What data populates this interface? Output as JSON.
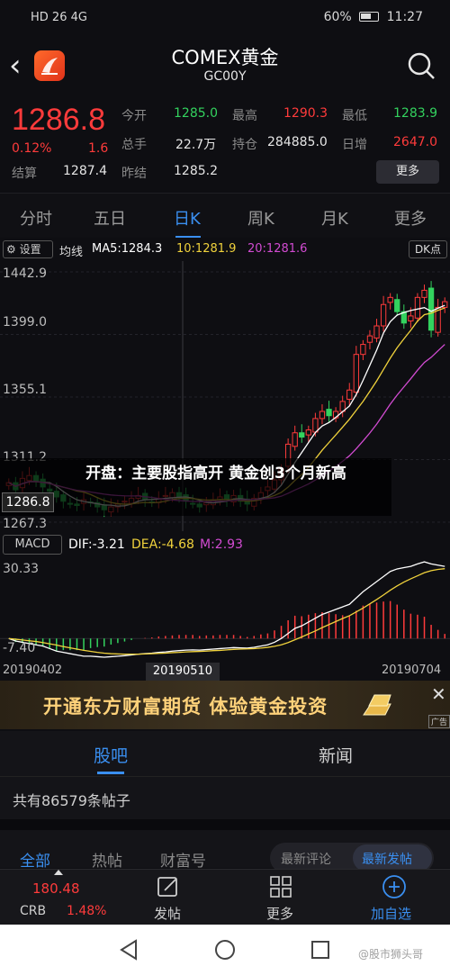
{
  "status_bar": {
    "left": "HD 26 4G",
    "battery": "60%",
    "time": "11:27"
  },
  "header": {
    "title": "COMEX黄金",
    "code": "GC00Y"
  },
  "quote": {
    "price": "1286.8",
    "change_pct": "0.12%",
    "change": "1.6",
    "settle_label": "结算",
    "settle": "1287.4",
    "open_label": "今开",
    "open": "1285.0",
    "high_label": "最高",
    "high": "1290.3",
    "low_label": "最低",
    "low": "1283.9",
    "volume_label": "总手",
    "volume": "22.7万",
    "oi_label": "持仓",
    "oi": "284885.0",
    "daily_inc_label": "日增",
    "daily_inc": "2647.0",
    "prev_settle_label": "昨结",
    "prev_settle": "1285.2",
    "more_label": "更多"
  },
  "tabs": {
    "t1": "分时",
    "t2": "五日",
    "t3": "日K",
    "t4": "周K",
    "t5": "月K",
    "t6": "更多"
  },
  "chart_toolbar": {
    "settings": "设置",
    "ma_label": "均线",
    "ma5": "MA5:1284.3",
    "ma10": "10:1281.9",
    "ma20": "20:1281.6",
    "dk": "DK点"
  },
  "y_labels": {
    "y1": "1442.9",
    "y2": "1399.0",
    "y3": "1355.1",
    "y4": "1311.2",
    "y5": "1267.3"
  },
  "price_marker": "1286.8",
  "news": "开盘：主要股指高开 黄金创3个月新高",
  "macd": {
    "label": "MACD",
    "dif": "DIF:-3.21",
    "dea": "DEA:-4.68",
    "m": "M:2.93",
    "top": "30.33",
    "bottom": "-7.40"
  },
  "dates": {
    "d1": "20190402",
    "d2": "20190510",
    "d3": "20190704"
  },
  "ad": {
    "text": "开通东方财富期货 体验黄金投资",
    "tag": "广告"
  },
  "sub_tabs": {
    "guba": "股吧",
    "news": "新闻"
  },
  "post_count": "共有86579条帖子",
  "filters": {
    "all": "全部",
    "hot": "热帖",
    "wealth": "财富号",
    "latest_comment": "最新评论",
    "latest_post": "最新发帖"
  },
  "bottom_nav": {
    "crb_value": "180.48",
    "crb_label": "CRB",
    "crb_pct": "1.48%",
    "post": "发帖",
    "more": "更多",
    "add": "加自选"
  },
  "watermark": "@股市狮头哥",
  "colors": {
    "up": "#ff3b3b",
    "down": "#33d25e",
    "accent": "#3a8ff0",
    "ma5": "#ffffff",
    "ma10": "#f0d23c",
    "ma20": "#d24bd2"
  },
  "chart_data": [
    {
      "type": "candlestick",
      "title": "",
      "x_start": "20190402",
      "x_end": "20190704",
      "ylim": [
        1267.3,
        1442.9
      ],
      "y_ticks": [
        1442.9,
        1399.0,
        1355.1,
        1311.2,
        1267.3
      ],
      "close": [
        1295,
        1290,
        1298,
        1300,
        1296,
        1292,
        1289,
        1285,
        1282,
        1280,
        1279,
        1283,
        1281,
        1278,
        1276,
        1278,
        1280,
        1282,
        1284,
        1286,
        1283,
        1281,
        1284,
        1286,
        1288,
        1285,
        1282,
        1280,
        1278,
        1281,
        1283,
        1285,
        1283,
        1286,
        1282,
        1280,
        1284,
        1288,
        1292,
        1297,
        1305,
        1322,
        1330,
        1327,
        1332,
        1340,
        1345,
        1342,
        1345,
        1352,
        1360,
        1385,
        1392,
        1398,
        1405,
        1420,
        1425,
        1415,
        1407,
        1412,
        1425,
        1430,
        1402,
        1418,
        1422
      ],
      "ma": [
        {
          "name": "MA5",
          "last": 1284.3
        },
        {
          "name": "10",
          "last": 1281.9
        },
        {
          "name": "20",
          "last": 1281.6
        }
      ]
    },
    {
      "type": "bar",
      "title": "MACD",
      "ylim": [
        -7.4,
        30.33
      ],
      "series": [
        {
          "name": "DIF",
          "last": -3.21
        },
        {
          "name": "DEA",
          "last": -4.68
        },
        {
          "name": "M",
          "last": 2.93
        }
      ],
      "dif": [
        0,
        -1,
        -1.5,
        -2,
        -2.5,
        -3,
        -4,
        -5,
        -5.5,
        -6,
        -6.5,
        -7,
        -7,
        -7.2,
        -7.4,
        -7.2,
        -7,
        -6.8,
        -6.5,
        -6.2,
        -6,
        -5.8,
        -5.5,
        -5.3,
        -5,
        -4.8,
        -4.6,
        -4.5,
        -4.6,
        -4.4,
        -4.2,
        -4,
        -3.8,
        -3.6,
        -3.7,
        -3.8,
        -3.5,
        -3,
        -2.5,
        -1.5,
        0,
        2,
        4,
        5,
        6.5,
        8,
        9.5,
        10.5,
        11.5,
        12.5,
        13.5,
        16,
        18.5,
        20.5,
        22.5,
        24.5,
        26.5,
        27.5,
        28,
        28.5,
        29.5,
        30.3,
        29.5,
        29,
        28.5
      ],
      "dea": [
        0,
        -0.3,
        -0.6,
        -0.9,
        -1.2,
        -1.6,
        -2.1,
        -2.6,
        -3.2,
        -3.7,
        -4.2,
        -4.7,
        -5.1,
        -5.5,
        -5.8,
        -6,
        -6.1,
        -6.2,
        -6.2,
        -6.2,
        -6.1,
        -6,
        -5.9,
        -5.8,
        -5.6,
        -5.5,
        -5.3,
        -5.2,
        -5.1,
        -5,
        -4.8,
        -4.7,
        -4.5,
        -4.3,
        -4.2,
        -4.1,
        -4,
        -3.8,
        -3.5,
        -3.1,
        -2.5,
        -1.6,
        -0.5,
        0.6,
        1.8,
        3,
        4.3,
        5.5,
        6.7,
        7.9,
        9,
        10.5,
        12,
        13.7,
        15.4,
        17.2,
        19.1,
        20.8,
        22.3,
        23.6,
        24.8,
        26,
        26.8,
        27.3,
        27.6
      ]
    }
  ]
}
